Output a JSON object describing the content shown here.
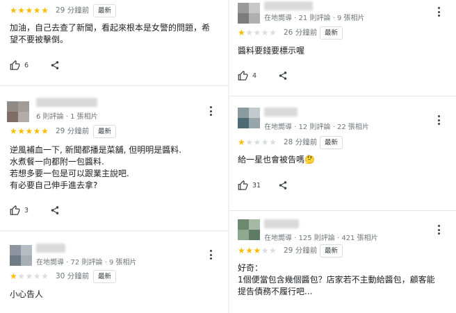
{
  "left_reviews": [
    {
      "stars_on": 5,
      "time": "29 分鐘前",
      "badge": "最新",
      "lines": [
        "加油，自己去查了新聞，看起來根本是女警的問題，希",
        "望不要被擊倒。"
      ],
      "likes": "6"
    },
    {
      "meta": "6 則評論 · 1 張相片",
      "stars_on": 5,
      "time": "29 分鐘前",
      "badge": "最新",
      "lines": [
        "逆風補血一下, 新聞都播是菜舖, 但明明是醬料.",
        "水煮餐一向都附一包醬料.",
        "若想多要一包是可以跟業主說吧.",
        "有必要自己伸手進去拿?"
      ],
      "likes": "3"
    },
    {
      "meta": "在地嚮導 · 72 則評論 · 9 張相片",
      "stars_on": 1,
      "time": "30 分鐘前",
      "badge": "最新",
      "lines": [
        "小心告人"
      ]
    }
  ],
  "right_reviews": [
    {
      "meta": "在地嚮導 · 21 則評論 · 9 張相片",
      "stars_on": 1,
      "time": "26 分鐘前",
      "badge": "最新",
      "lines": [
        "醬料要錢要標示喔"
      ],
      "likes": "4"
    },
    {
      "meta": "在地嚮導 · 12 則評論 · 22 張相片",
      "stars_on": 1,
      "time": "28 分鐘前",
      "badge": "最新",
      "lines": [
        "給一星也會被告嗎🤔"
      ],
      "likes": "31"
    },
    {
      "meta": "在地嚮導 · 125 則評論 · 421 張相片",
      "stars_on": 3,
      "time": "29 分鐘前",
      "badge": "最新",
      "lines": [
        "好奇：",
        "1個便當包含幾個醬包？店家若不主動給醬包，顧客能",
        "提告債務不履行吧..."
      ]
    }
  ],
  "icons": {
    "star": "star-icon",
    "like": "thumb-up-icon",
    "share": "share-icon",
    "more": "more-vert-icon"
  },
  "colors": {
    "star_on": "#fbbc04",
    "star_off": "#dadce0",
    "text": "#202124",
    "meta": "#70757a"
  }
}
